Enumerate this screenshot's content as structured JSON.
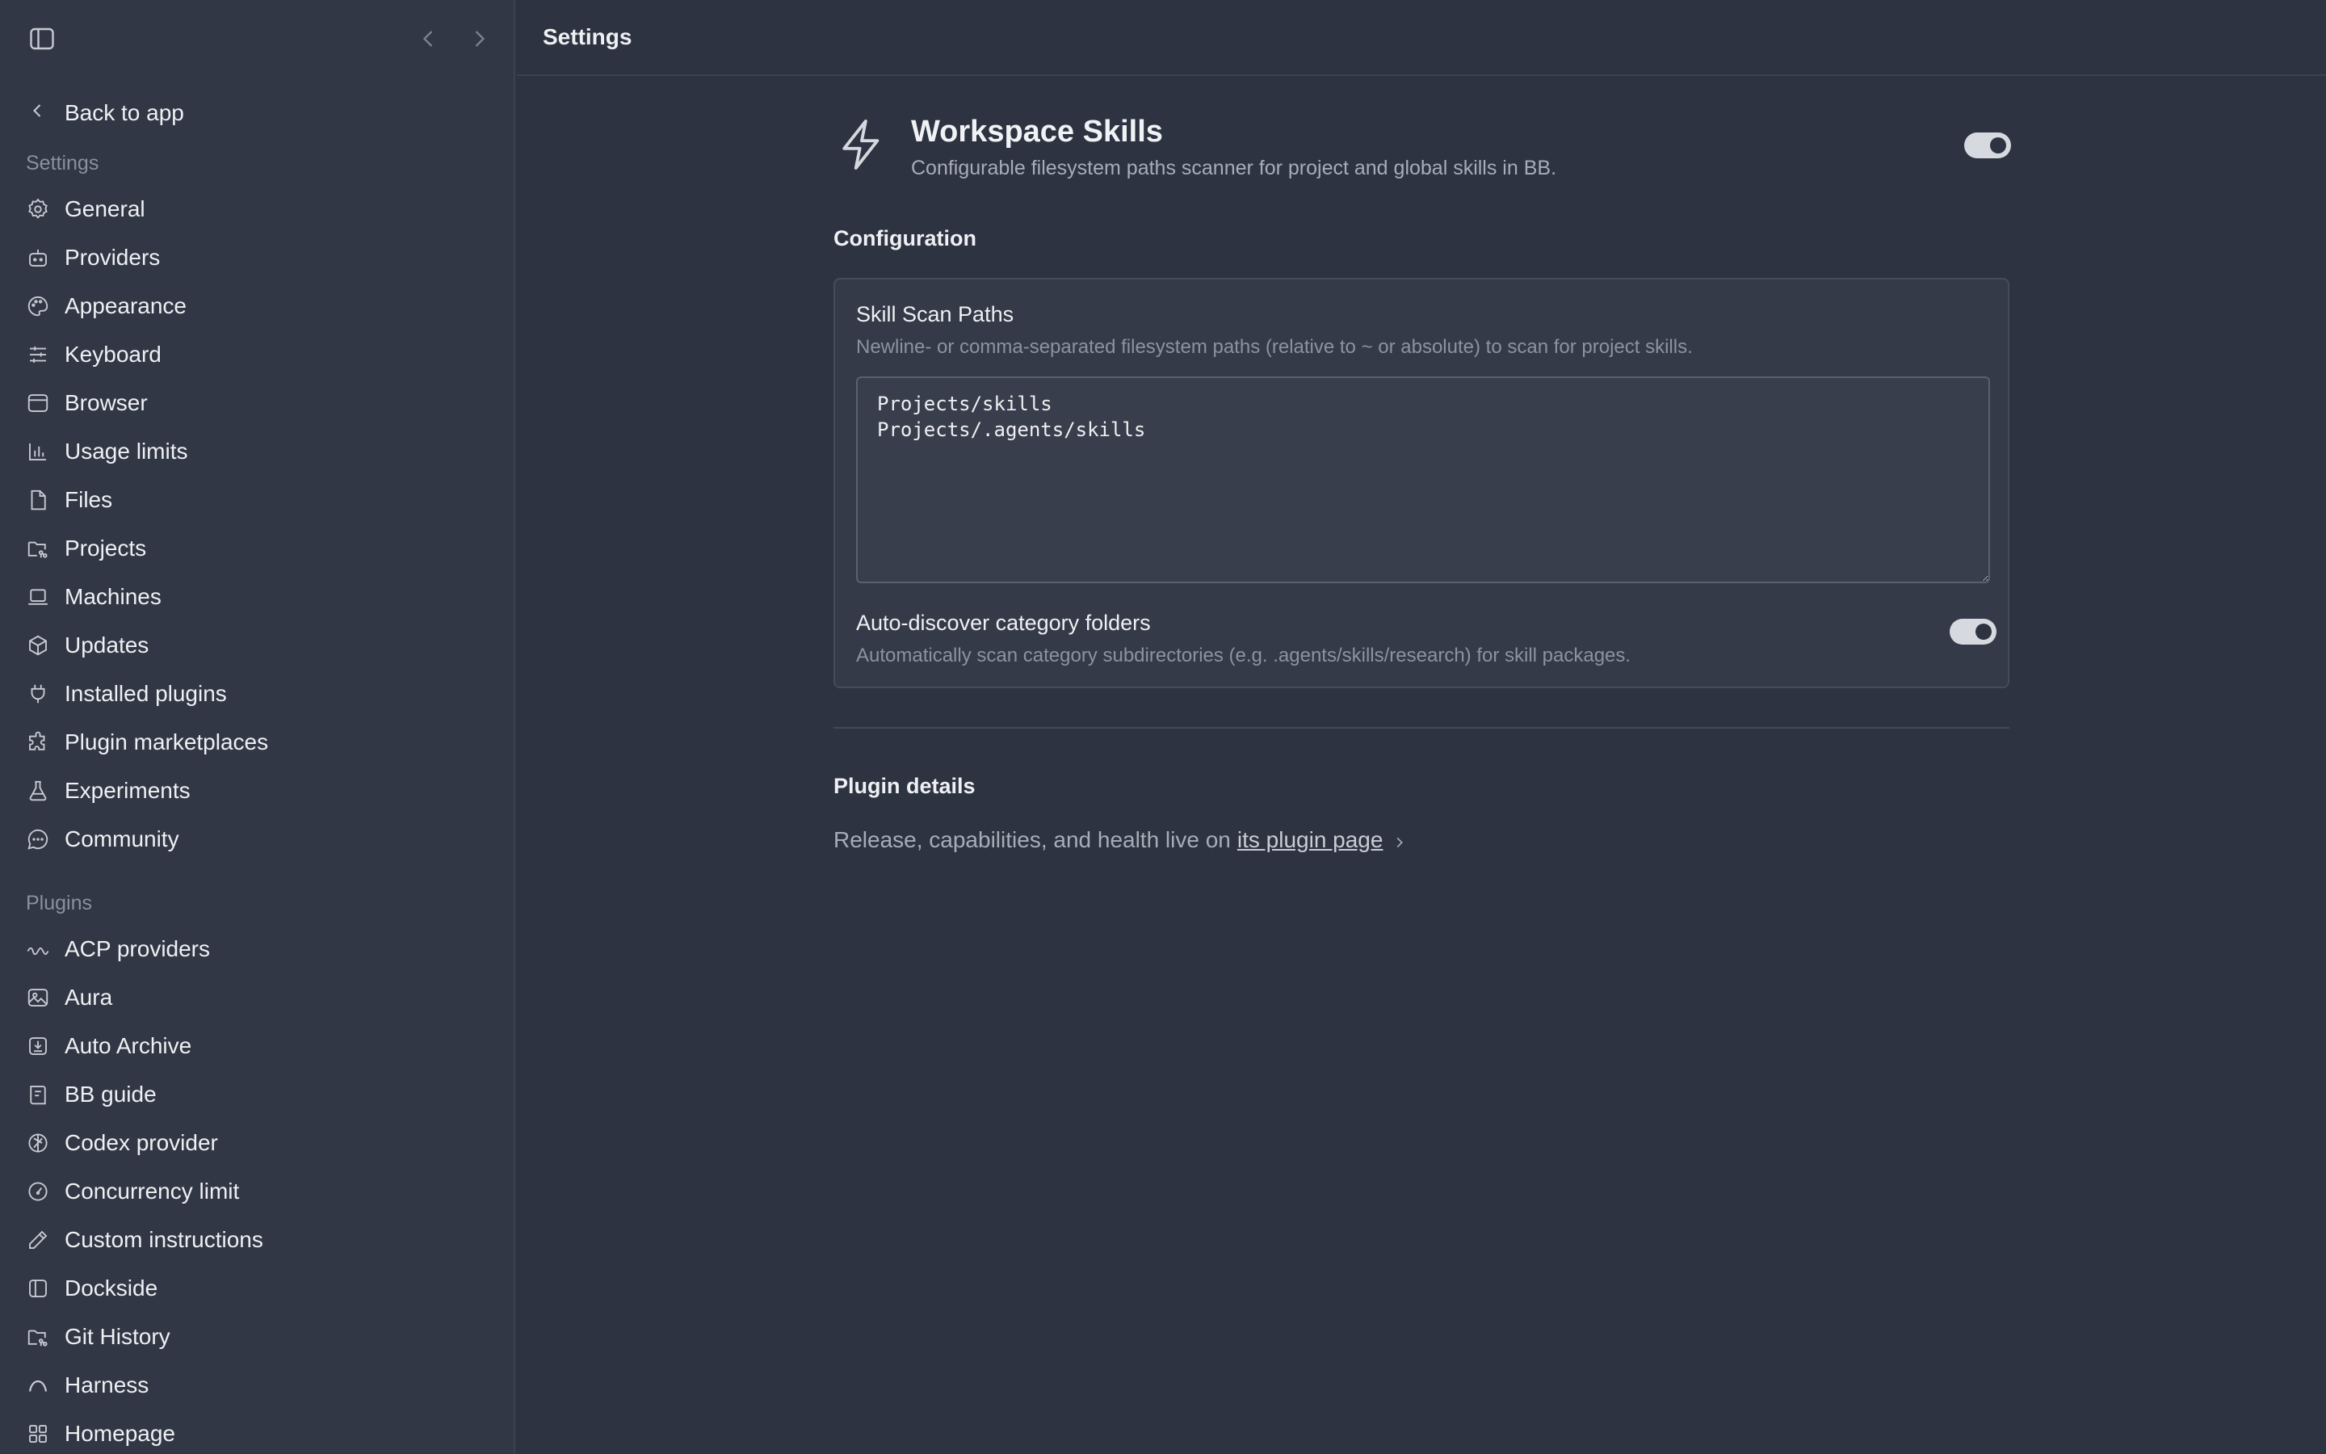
{
  "sidebar": {
    "back_label": "Back to app",
    "settings_label": "Settings",
    "plugins_label": "Plugins",
    "settings_items": [
      {
        "label": "General",
        "icon": "gear-icon"
      },
      {
        "label": "Providers",
        "icon": "bot-icon"
      },
      {
        "label": "Appearance",
        "icon": "palette-icon"
      },
      {
        "label": "Keyboard",
        "icon": "sliders-icon"
      },
      {
        "label": "Browser",
        "icon": "browser-icon"
      },
      {
        "label": "Usage limits",
        "icon": "bar-chart-icon"
      },
      {
        "label": "Files",
        "icon": "file-icon"
      },
      {
        "label": "Projects",
        "icon": "folder-git-icon"
      },
      {
        "label": "Machines",
        "icon": "laptop-icon"
      },
      {
        "label": "Updates",
        "icon": "package-icon"
      },
      {
        "label": "Installed plugins",
        "icon": "plug-icon"
      },
      {
        "label": "Plugin marketplaces",
        "icon": "puzzle-icon"
      },
      {
        "label": "Experiments",
        "icon": "flask-icon"
      },
      {
        "label": "Community",
        "icon": "chat-bubble-icon"
      }
    ],
    "plugin_items": [
      {
        "label": "ACP providers",
        "icon": "wave-icon"
      },
      {
        "label": "Aura",
        "icon": "image-icon"
      },
      {
        "label": "Auto Archive",
        "icon": "archive-icon"
      },
      {
        "label": "BB guide",
        "icon": "book-icon"
      },
      {
        "label": "Codex provider",
        "icon": "openai-icon"
      },
      {
        "label": "Concurrency limit",
        "icon": "gauge-icon"
      },
      {
        "label": "Custom instructions",
        "icon": "pencil-icon"
      },
      {
        "label": "Dockside",
        "icon": "panel-left-icon"
      },
      {
        "label": "Git History",
        "icon": "folder-git-icon"
      },
      {
        "label": "Harness",
        "icon": "arc-icon"
      },
      {
        "label": "Homepage",
        "icon": "grid-icon"
      }
    ]
  },
  "topbar": {
    "title": "Settings"
  },
  "plugin": {
    "title": "Workspace Skills",
    "description": "Configurable filesystem paths scanner for project and global skills in BB.",
    "enabled": true
  },
  "configuration": {
    "title": "Configuration",
    "scan_paths": {
      "label": "Skill Scan Paths",
      "help": "Newline- or comma-separated filesystem paths (relative to ~ or absolute) to scan for project skills.",
      "value": "Projects/skills\nProjects/.agents/skills"
    },
    "auto_discover": {
      "label": "Auto-discover category folders",
      "help": "Automatically scan category subdirectories (e.g. .agents/skills/research) for skill packages.",
      "enabled": true
    }
  },
  "details": {
    "title": "Plugin details",
    "text": "Release, capabilities, and health live on",
    "link": "its plugin page"
  }
}
